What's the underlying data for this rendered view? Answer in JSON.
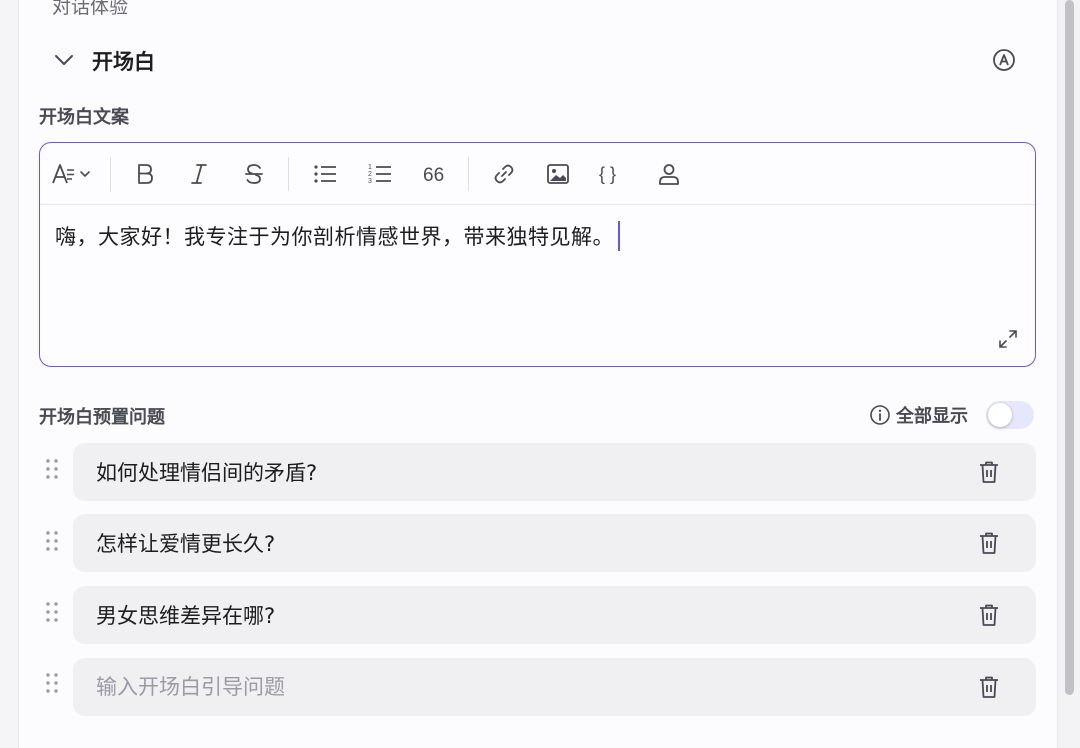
{
  "section": {
    "title": "对话体验"
  },
  "group": {
    "title": "开场白"
  },
  "opening_text": {
    "label": "开场白文案",
    "content": "嗨，大家好！我专注于为你剖析情感世界，带来独特见解。"
  },
  "toolbar": {
    "items": [
      "text-style",
      "bold",
      "italic",
      "strikethrough",
      "bullet-list",
      "numbered-list",
      "quote",
      "link",
      "image",
      "code",
      "user"
    ]
  },
  "preset_questions": {
    "label": "开场白预置问题",
    "show_all_label": "全部显示",
    "show_all_on": false,
    "questions": [
      "如何处理情侣间的矛盾?",
      "怎样让爱情更长久?",
      "男女思维差异在哪?"
    ],
    "new_placeholder": "输入开场白引导问题"
  },
  "colors": {
    "accent": "#6857e0",
    "row_bg": "#f0f0f3",
    "toggle_off": "#e6e7fb"
  }
}
